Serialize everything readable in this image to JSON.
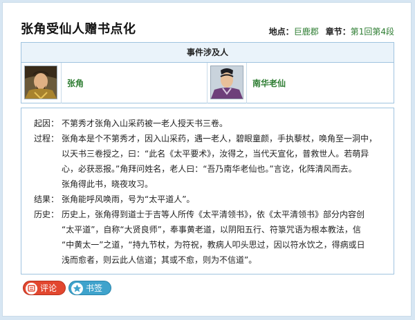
{
  "header": {
    "title": "张角受仙人赠书点化",
    "location_label": "地点：",
    "location_value": "巨鹿郡",
    "chapter_label": "章节：",
    "chapter_value": "第1回第4段"
  },
  "people": {
    "heading": "事件涉及人",
    "items": [
      {
        "name": "张角",
        "avatar_icon": "zhang-jiao-portrait"
      },
      {
        "name": "南华老仙",
        "avatar_icon": "nanhua-laoxian-portrait"
      }
    ]
  },
  "story": {
    "cause_label": "起因：",
    "cause_text": "不第秀才张角入山采药被一老人授天书三卷。",
    "process_label": "过程：",
    "process_text": "张角本是个不第秀才，因入山采药，遇一老人，碧眼童颜，手执藜杖，唤角至一洞中，\n以天书三卷授之，曰：“此名《太平要术》，汝得之，当代天宣化，普救世人。若萌异\n心，必获恶报。”角拜问姓名，老人曰：“吾乃南华老仙也。”言讫，化阵清风而去。\n张角得此书，晓夜攻习。",
    "result_label": "结果：",
    "result_text": "张角能呼风唤雨，号为“太平道人”。",
    "history_label": "历史：",
    "history_text": "历史上，张角得到道士于吉等人所传《太平清领书》，依《太平清领书》部分内容创\n“太平道”，自称“大贤良师”，奉事黄老道，以阴阳五行、符箓咒语为根本教法，信\n“中黄太一”之道，“持九节杖，为符祝，教病人叩头思过，因以符水饮之，得病或日\n浅而愈者，则云此人信道；其或不愈，则为不信道”。"
  },
  "actions": {
    "comment_label": "评论",
    "comment_icon": "comment-icon",
    "bookmark_label": "书签",
    "bookmark_icon": "star-icon"
  },
  "colors": {
    "accent_green": "#2e7d32",
    "border_blue": "#9fc3df",
    "comment_red": "#e2472f",
    "bookmark_blue": "#3fa3cc"
  }
}
